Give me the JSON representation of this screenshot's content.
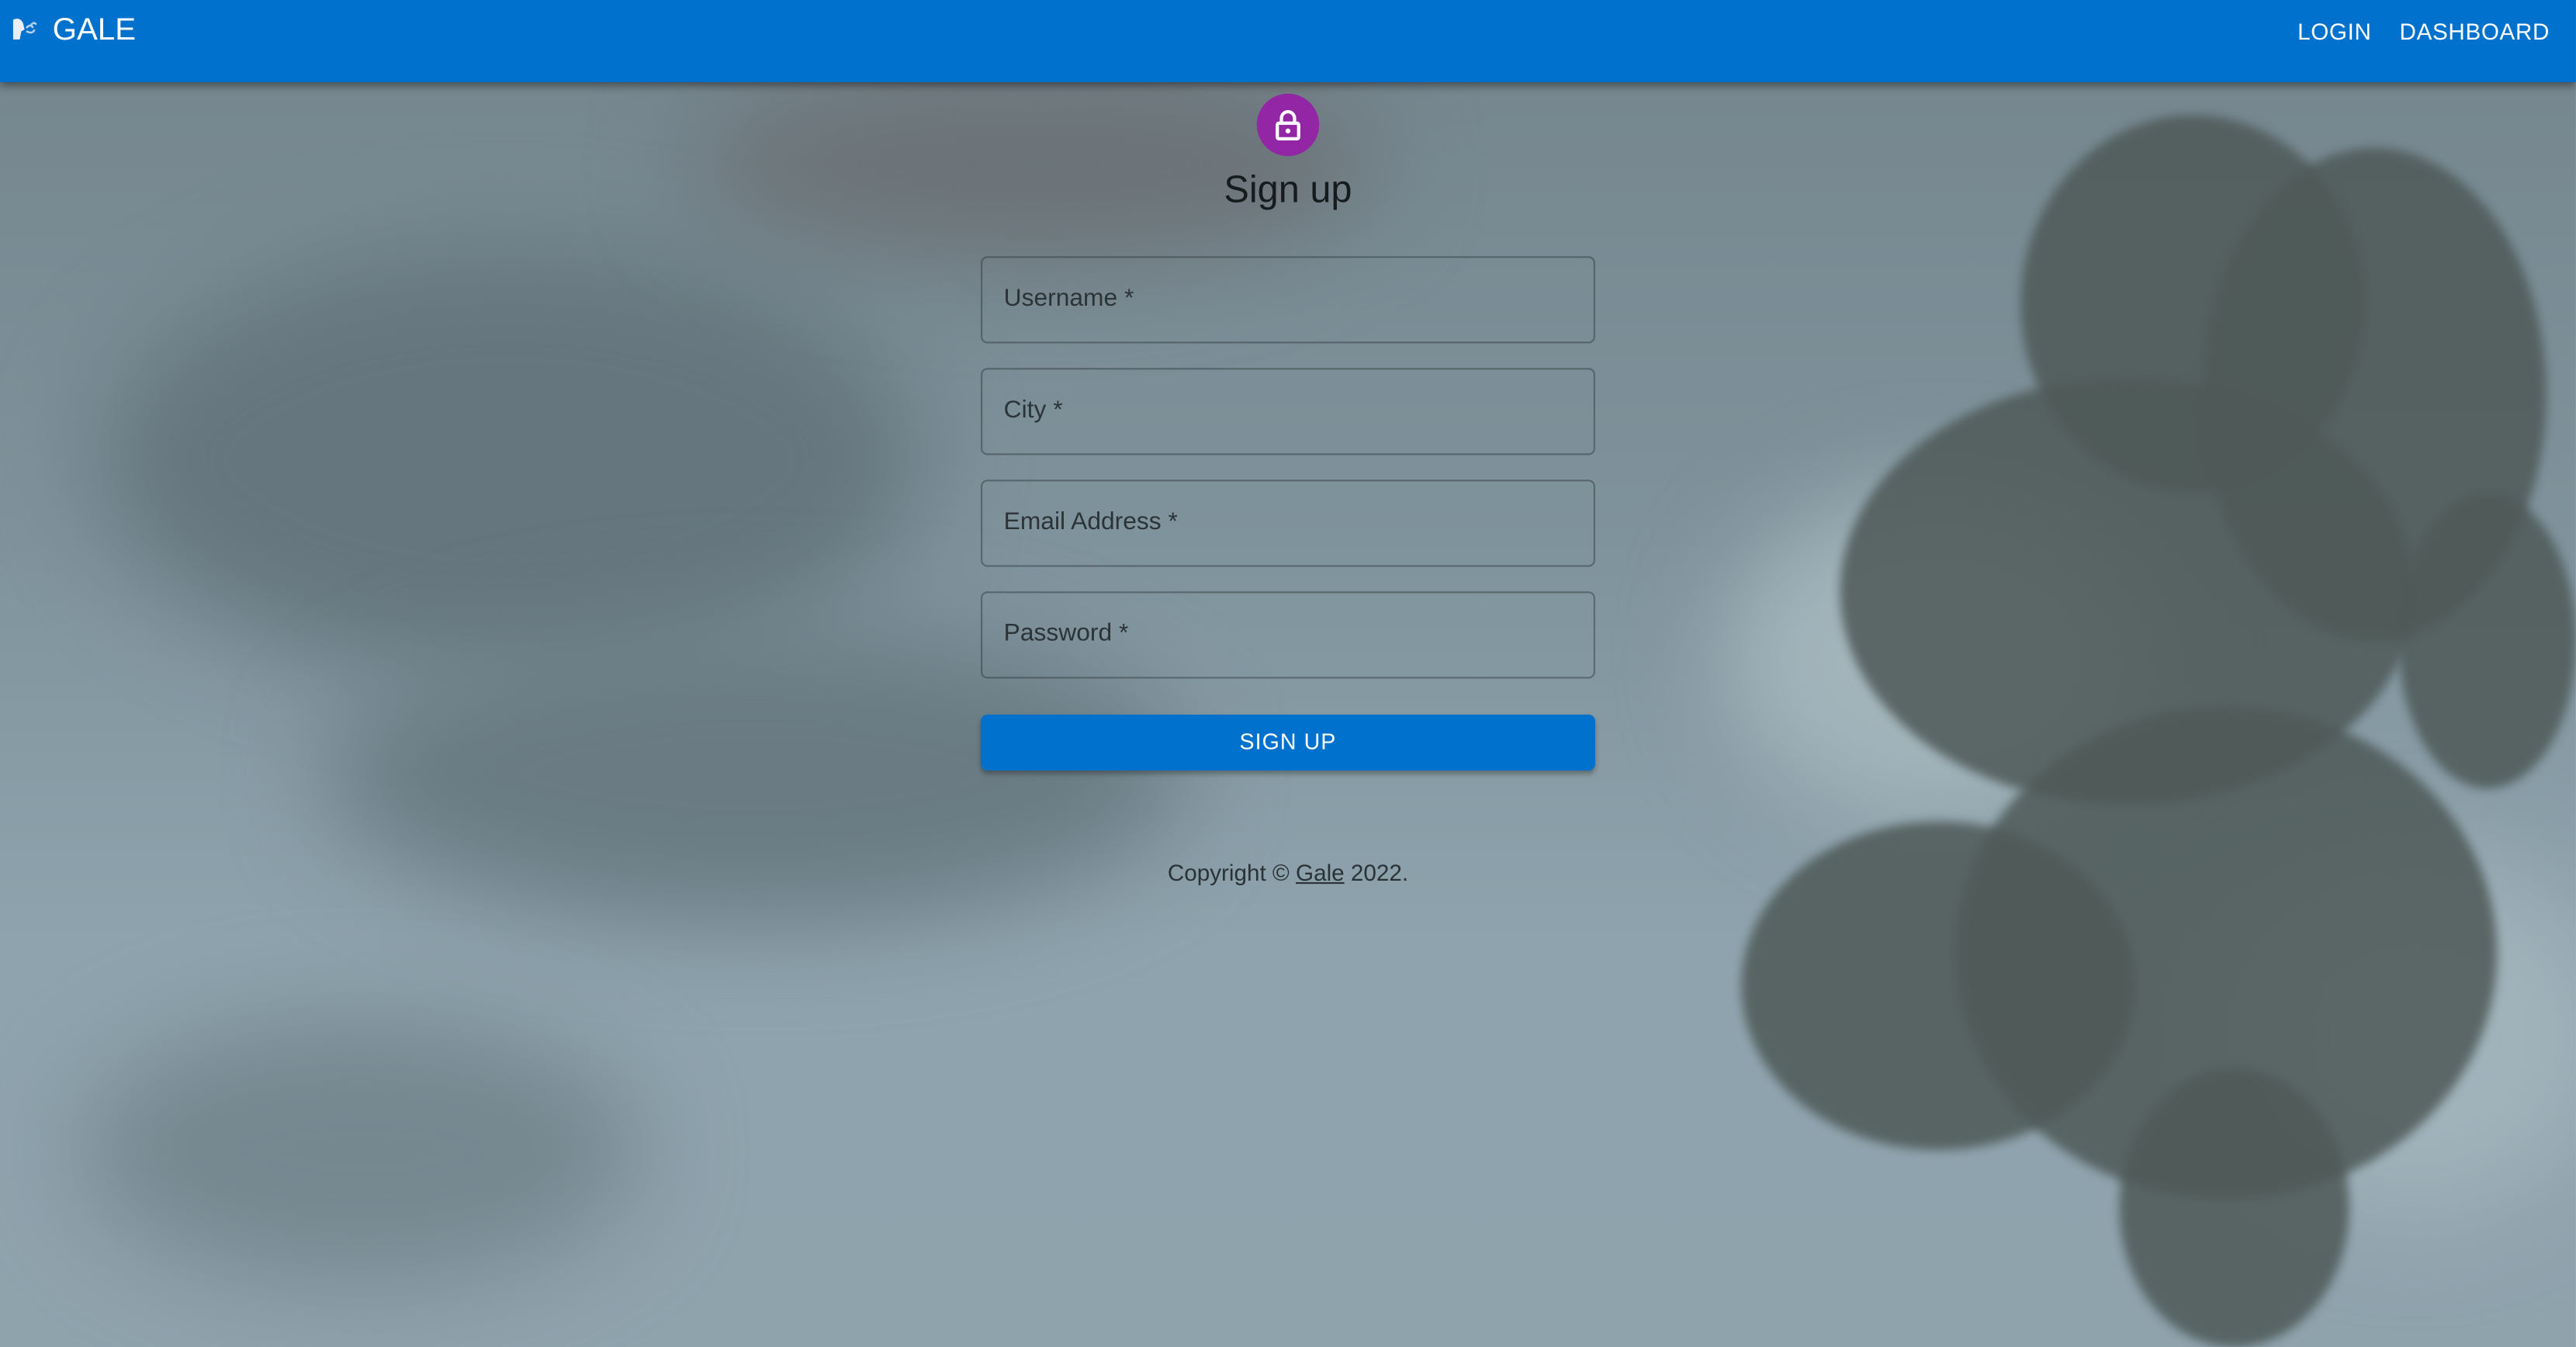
{
  "appbar": {
    "brand": "GALE",
    "logo_icon": "wind-face-icon",
    "nav": [
      "LOGIN",
      "DASHBOARD"
    ],
    "color": "#0071cc"
  },
  "form": {
    "avatar_icon": "lock-icon",
    "avatar_color": "#9226a5",
    "title": "Sign up",
    "fields": [
      {
        "label": "Username *",
        "value": ""
      },
      {
        "label": "City *",
        "value": ""
      },
      {
        "label": "Email Address *",
        "value": ""
      },
      {
        "label": "Password *",
        "value": ""
      }
    ],
    "submit": "SIGN UP"
  },
  "footer": {
    "prefix": "Copyright © ",
    "link": "Gale",
    "suffix": " 2022."
  }
}
